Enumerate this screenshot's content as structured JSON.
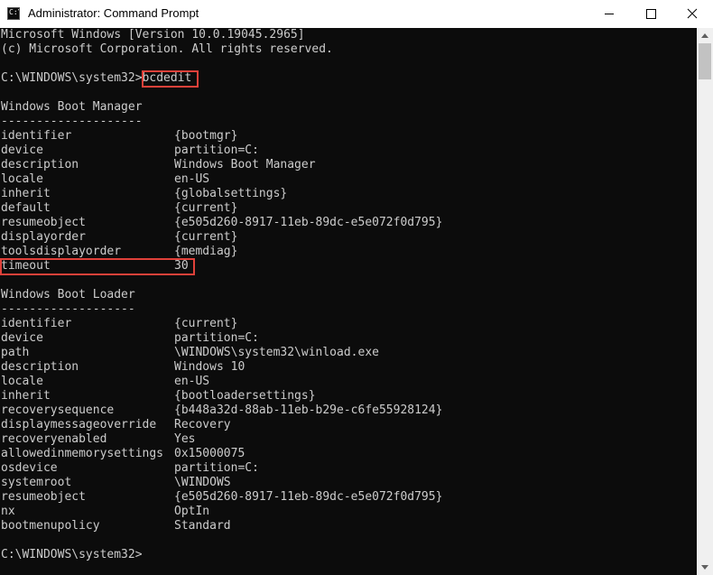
{
  "window": {
    "title": "Administrator: Command Prompt",
    "icon_text": "C:\\",
    "buttons": {
      "minimize": "minimize-icon",
      "maximize": "maximize-icon",
      "close": "close-icon"
    }
  },
  "console": {
    "header": [
      "Microsoft Windows [Version 10.0.19045.2965]",
      "(c) Microsoft Corporation. All rights reserved."
    ],
    "prompt": "C:\\WINDOWS\\system32>",
    "command": "bcdedit",
    "boot_manager": {
      "title": "Windows Boot Manager",
      "separator": "--------------------",
      "entries": [
        {
          "key": "identifier",
          "value": "{bootmgr}"
        },
        {
          "key": "device",
          "value": "partition=C:"
        },
        {
          "key": "description",
          "value": "Windows Boot Manager"
        },
        {
          "key": "locale",
          "value": "en-US"
        },
        {
          "key": "inherit",
          "value": "{globalsettings}"
        },
        {
          "key": "default",
          "value": "{current}"
        },
        {
          "key": "resumeobject",
          "value": "{e505d260-8917-11eb-89dc-e5e072f0d795}"
        },
        {
          "key": "displayorder",
          "value": "{current}"
        },
        {
          "key": "toolsdisplayorder",
          "value": "{memdiag}"
        },
        {
          "key": "timeout",
          "value": "30"
        }
      ]
    },
    "boot_loader": {
      "title": "Windows Boot Loader",
      "separator": "-------------------",
      "entries": [
        {
          "key": "identifier",
          "value": "{current}"
        },
        {
          "key": "device",
          "value": "partition=C:"
        },
        {
          "key": "path",
          "value": "\\WINDOWS\\system32\\winload.exe"
        },
        {
          "key": "description",
          "value": "Windows 10"
        },
        {
          "key": "locale",
          "value": "en-US"
        },
        {
          "key": "inherit",
          "value": "{bootloadersettings}"
        },
        {
          "key": "recoverysequence",
          "value": "{b448a32d-88ab-11eb-b29e-c6fe55928124}"
        },
        {
          "key": "displaymessageoverride",
          "value": "Recovery"
        },
        {
          "key": "recoveryenabled",
          "value": "Yes"
        },
        {
          "key": "allowedinmemorysettings",
          "value": "0x15000075"
        },
        {
          "key": "osdevice",
          "value": "partition=C:"
        },
        {
          "key": "systemroot",
          "value": "\\WINDOWS"
        },
        {
          "key": "resumeobject",
          "value": "{e505d260-8917-11eb-89dc-e5e072f0d795}"
        },
        {
          "key": "nx",
          "value": "OptIn"
        },
        {
          "key": "bootmenupolicy",
          "value": "Standard"
        }
      ]
    },
    "final_prompt": "C:\\WINDOWS\\system32>"
  },
  "colors": {
    "console_bg": "#0c0c0c",
    "console_text": "#cccccc",
    "highlight": "#e0413a"
  }
}
